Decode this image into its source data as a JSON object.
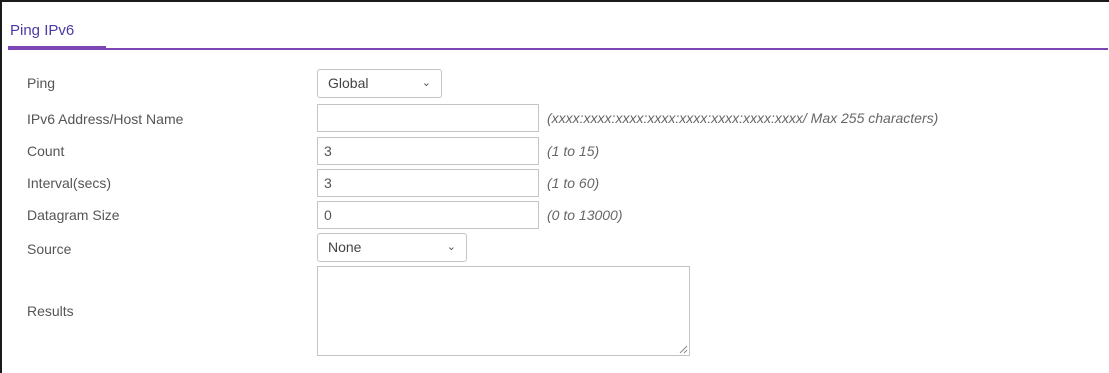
{
  "panel": {
    "title": "Ping IPv6"
  },
  "form": {
    "ping": {
      "label": "Ping",
      "value": "Global"
    },
    "address": {
      "label": "IPv6 Address/Host Name",
      "value": "",
      "hint": "(xxxx:xxxx:xxxx:xxxx:xxxx:xxxx:xxxx:xxxx/ Max 255 characters)"
    },
    "count": {
      "label": "Count",
      "value": "3",
      "hint": "(1 to 15)"
    },
    "interval": {
      "label": "Interval(secs)",
      "value": "3",
      "hint": "(1 to 60)"
    },
    "datagram": {
      "label": "Datagram Size",
      "value": "0",
      "hint": "(0 to 13000)"
    },
    "source": {
      "label": "Source",
      "value": "None"
    },
    "results": {
      "label": "Results",
      "value": ""
    }
  },
  "icons": {
    "dropdown": "chevron-down-icon",
    "resize": "resize-grip-icon"
  },
  "colors": {
    "title": "#4b3aa3",
    "underline": "#7b46b4"
  }
}
